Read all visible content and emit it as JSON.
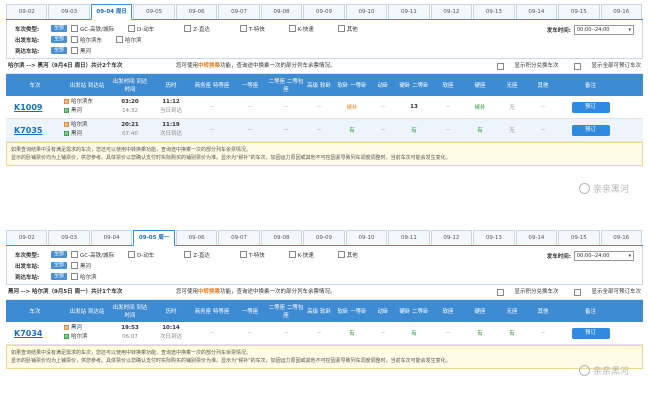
{
  "screen1": {
    "tabs": [
      "09-02",
      "09-03",
      "09-04 周日",
      "09-05",
      "09-06",
      "09-07",
      "09-08",
      "09-09",
      "09-10",
      "09-11",
      "09-12",
      "09-13",
      "09-14",
      "09-15",
      "09-16"
    ],
    "filters": {
      "type_label": "车次类型:",
      "from_label": "出发车站:",
      "to_label": "到达车站:",
      "all": "全部",
      "types": [
        "GC-高铁/城际",
        "D-动车",
        "Z-直达",
        "T-特快",
        "K-快速",
        "其他"
      ],
      "from_opts": [
        "哈尔滨东",
        "哈尔滨"
      ],
      "to_opts": [
        "黑河"
      ],
      "dep_label": "发车时间:",
      "dep_value": "00:00--24:00"
    },
    "route": {
      "left": "哈尔滨 --> 黑河（9月4日 周日）共计2个车次",
      "mid_pre": "您可使用",
      "mid_b": "中转换乘",
      "mid_post": "功能，查询途中换乘一次的部分列车余票情况。",
      "opt1": "显示积分兑换车次",
      "opt2": "显示全部可预订车次"
    },
    "headers": [
      "车次",
      "出发站 到达站",
      "出发时间 到达时间",
      "历时",
      "商务座 特等座",
      "一等座",
      "二等座 二等包座",
      "高级 软卧",
      "软卧 一等卧",
      "动卧",
      "硬卧 二等卧",
      "软座",
      "硬座",
      "无座",
      "其他",
      "备注"
    ],
    "rows": [
      {
        "train": "K1009",
        "from": "哈尔滨东",
        "to": "黑河",
        "dep": "03:20",
        "arr": "14:32",
        "dur": "11:12",
        "dur2": "当日到达",
        "c4": "--",
        "c5": "--",
        "c6": "--",
        "c7": "--",
        "c8": "候补",
        "c9": "--",
        "c10": "13",
        "c11": "--",
        "c12": "候补",
        "c13": "无",
        "c14": "--",
        "btn": "预订"
      },
      {
        "train": "K7035",
        "from": "哈尔滨",
        "to": "黑河",
        "dep": "20:21",
        "arr": "07:40",
        "dur": "11:19",
        "dur2": "次日到达",
        "c4": "--",
        "c5": "--",
        "c6": "--",
        "c7": "--",
        "c8": "有",
        "c9": "--",
        "c10": "有",
        "c11": "--",
        "c12": "有",
        "c13": "无",
        "c14": "--",
        "btn": "预订"
      }
    ],
    "notice": [
      "如果查询结果中没有满足需求的车次，您还可以使用中转换乘功能，查询途中换乘一次的部分列车余票情况。",
      "显示的卧铺票价均为上铺票价，供您参考。具体票价以您确认支付时实际购买的铺别票价为准。显示为\"候补\"的车次，加因运力原因或其他不可控因素导致列车调度调整时，当前车次可能会发生变化。"
    ]
  },
  "screen2": {
    "tabs": [
      "09-02",
      "09-03",
      "09-04",
      "09-05 周一",
      "09-06",
      "09-07",
      "09-08",
      "09-09",
      "09-10",
      "09-11",
      "09-12",
      "09-13",
      "09-14",
      "09-15",
      "09-16"
    ],
    "filters": {
      "type_label": "车次类型:",
      "from_label": "出发车站:",
      "to_label": "到达车站:",
      "all": "全部",
      "types": [
        "GC-高铁/城际",
        "D-动车",
        "Z-直达",
        "T-特快",
        "K-快速",
        "其他"
      ],
      "from_opts": [
        "黑河"
      ],
      "to_opts": [
        "哈尔滨"
      ],
      "dep_label": "发车时间:",
      "dep_value": "00:00--24:00"
    },
    "route": {
      "left": "黑河 --> 哈尔滨（9月5日 周一）共计1个车次",
      "mid_pre": "您可使用",
      "mid_b": "中转换乘",
      "mid_post": "功能，查询途中换乘一次的部分列车余票情况。",
      "opt1": "显示积分兑换车次",
      "opt2": "显示全部可预订车次"
    },
    "headers": [
      "车次",
      "出发站 到达站",
      "出发时间 到达时间",
      "历时",
      "商务座 特等座",
      "一等座",
      "二等座 二等包座",
      "高级 软卧",
      "软卧 一等卧",
      "动卧",
      "硬卧 二等卧",
      "软座",
      "硬座",
      "无座",
      "其他",
      "备注"
    ],
    "rows": [
      {
        "train": "K7034",
        "from": "黑河",
        "to": "哈尔滨",
        "dep": "19:53",
        "arr": "06:07",
        "dur": "10:14",
        "dur2": "次日到达",
        "c4": "--",
        "c5": "--",
        "c6": "--",
        "c7": "--",
        "c8": "有",
        "c9": "--",
        "c10": "有",
        "c11": "--",
        "c12": "有",
        "c13": "有",
        "c14": "--",
        "btn": "预订"
      }
    ],
    "notice": [
      "如果查询结果中没有满足需求的车次，您还可以使用中转换乘功能，查询途中换乘一次的部分列车余票情况。",
      "显示的卧铺票价均为上铺票价，供您参考。具体票价以您确认支付时实际购买的铺别票价为准。显示为\"候补\"的车次，加因运力原因或其他不可控因素导致列车调度调整时，当前车次可能会发生变化。"
    ]
  },
  "watermark": "亲亲黑河",
  "colors": {
    "accent": "#3d8bd3",
    "green": "#2b9a3a",
    "orange": "#e67e22"
  }
}
